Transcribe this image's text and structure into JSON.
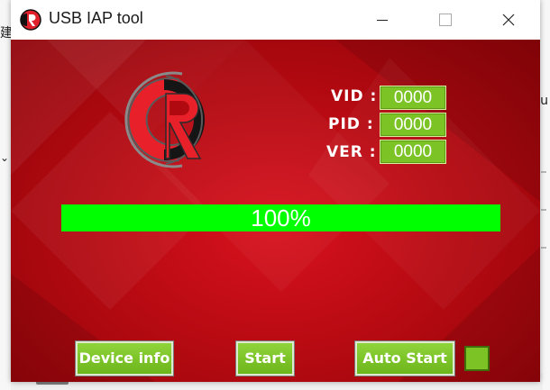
{
  "window": {
    "title": "USB IAP tool"
  },
  "icons": {
    "app": "app-logo-icon",
    "minimize": "minimize-icon",
    "maximize": "maximize-icon",
    "close": "close-icon"
  },
  "device": {
    "vid_label": "VID :",
    "vid_value": "0000",
    "pid_label": "PID :",
    "pid_value": "0000",
    "ver_label": "VER :",
    "ver_value": "0000"
  },
  "progress": {
    "value": 1.0,
    "text": "100%"
  },
  "buttons": {
    "device_info": "Device info",
    "start": "Start",
    "auto_start": "Auto  Start"
  },
  "colors": {
    "client_red": "#c10c16",
    "field_green": "#7cc326",
    "progress_green": "#00ff00"
  },
  "background": {
    "left_glyph": "建",
    "right_glyph": "u",
    "left_chevron": "⌄"
  }
}
